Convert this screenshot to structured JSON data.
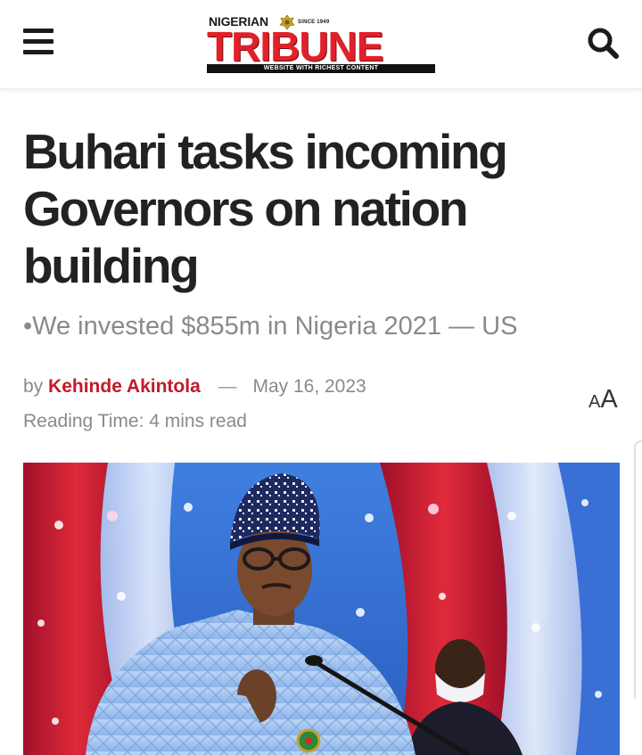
{
  "header": {
    "logo": {
      "top_word": "NIGERIAN",
      "since": "SINCE 1949",
      "name": "TRIBUNE",
      "tagline": "WEBSITE WITH RICHEST CONTENT"
    },
    "menu_icon": "hamburger-menu-icon",
    "search_icon": "search-icon"
  },
  "article": {
    "headline": "Buhari tasks incoming Governors on nation building",
    "subheadline": "•We invested $855m in Nigeria 2021 — US",
    "byline_prefix": "by",
    "author": "Kehinde Akintola",
    "separator": "—",
    "date": "May 16, 2023",
    "reading_time": "Reading Time: 4 mins read",
    "font_toggle_small": "A",
    "font_toggle_large": "A"
  },
  "colors": {
    "brand_red": "#e2202a",
    "author_red": "#c21a2a",
    "headline": "#222222",
    "muted": "#8a8a8a"
  }
}
